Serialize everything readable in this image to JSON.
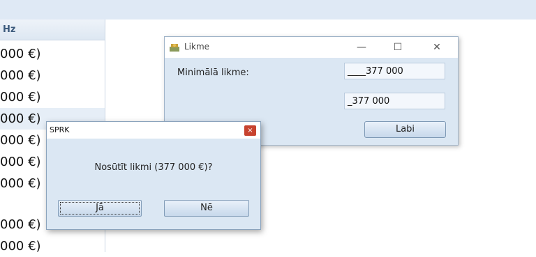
{
  "table": {
    "header": "Hz",
    "rows": [
      "000 €)",
      "000 €)",
      "000 €)",
      "000 €)",
      "000 €)",
      "000 €)",
      "000 €)",
      "",
      "000 €)",
      "000 €)"
    ]
  },
  "likme_window": {
    "title": "Likme",
    "app_icon": "app-icon",
    "minimize": "—",
    "maximize": "☐",
    "close": "✕",
    "min_label": "Minimālā likme:",
    "field1_value": "____377 000",
    "field2_value": "_377 000",
    "ok_label": "Labi"
  },
  "sprk_dialog": {
    "title": "SPRK",
    "close": "×",
    "message": "Nosūtīt likmi (377 000 €)?",
    "yes_label": "Jā",
    "no_label": "Nē"
  }
}
